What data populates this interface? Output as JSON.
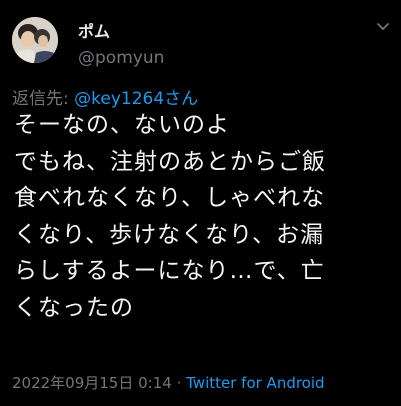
{
  "tweet": {
    "display_name": "ポム",
    "handle": "@pomyun",
    "reply_prefix": "返信先: ",
    "reply_mention": "@key1264さん",
    "body": "そーなの、ないのよ\nでもね、注射のあとからご飯\n食べれなくなり、しゃべれな\nくなり、歩けなくなり、お漏\nらしするよーになり…で、亡\nくなったの",
    "timestamp": "2022年09月15日 0:14",
    "separator": " · ",
    "source": "Twitter for Android"
  },
  "icons": {
    "menu": "chevron-down-icon",
    "avatar": "profile-avatar"
  },
  "colors": {
    "background": "#000000",
    "text": "#e7e9ea",
    "muted": "#71767b",
    "link": "#1d9bf0"
  }
}
